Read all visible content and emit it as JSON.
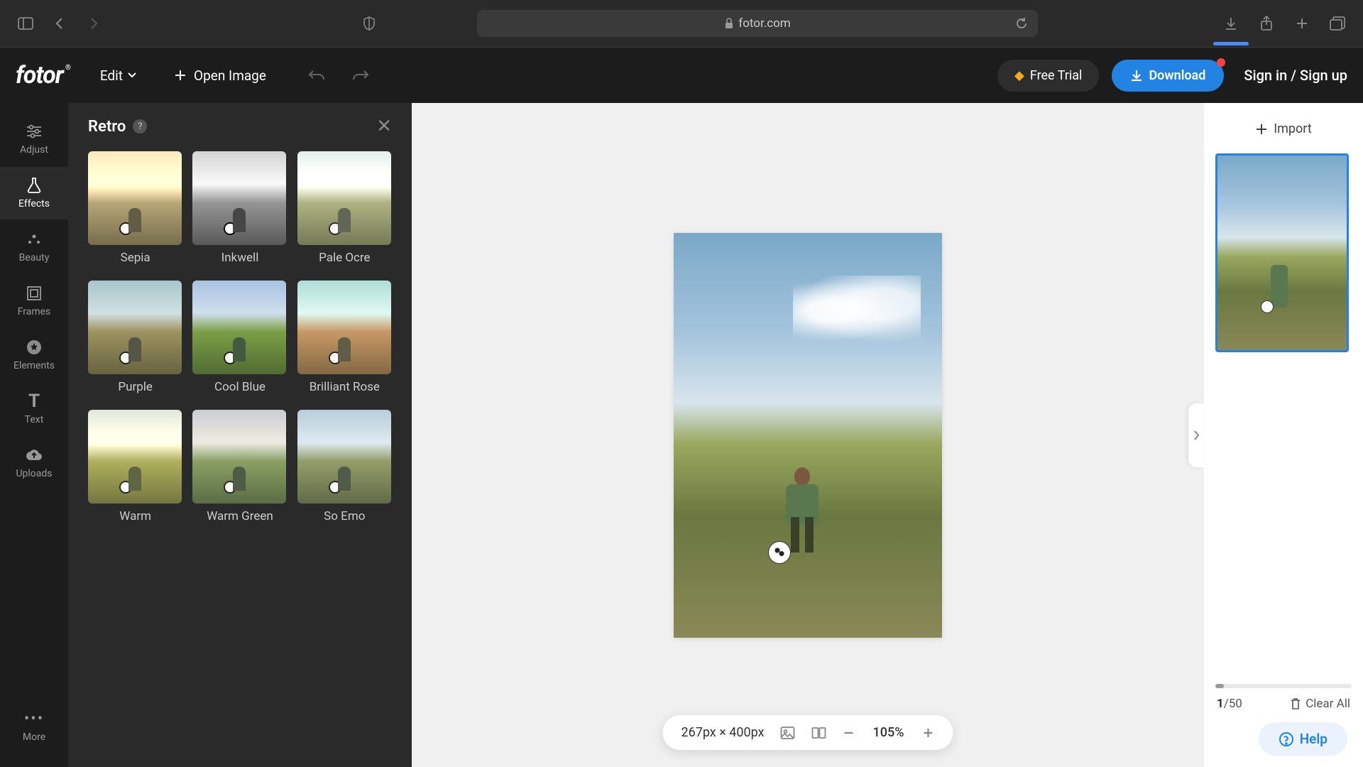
{
  "browser": {
    "url": "fotor.com"
  },
  "header": {
    "logo": "fotor",
    "edit_label": "Edit",
    "open_image_label": "Open Image",
    "free_trial_label": "Free Trial",
    "download_label": "Download",
    "auth_label": "Sign in / Sign up"
  },
  "left_nav": {
    "items": [
      {
        "label": "Adjust",
        "icon": "sliders"
      },
      {
        "label": "Effects",
        "icon": "flask",
        "active": true
      },
      {
        "label": "Beauty",
        "icon": "sparkle"
      },
      {
        "label": "Frames",
        "icon": "frame"
      },
      {
        "label": "Elements",
        "icon": "star"
      },
      {
        "label": "Text",
        "icon": "text"
      },
      {
        "label": "Uploads",
        "icon": "cloud"
      }
    ],
    "more_label": "More"
  },
  "panel": {
    "title": "Retro",
    "effects": [
      {
        "key": "sepia",
        "label": "Sepia"
      },
      {
        "key": "inkwell",
        "label": "Inkwell"
      },
      {
        "key": "paleocre",
        "label": "Pale Ocre"
      },
      {
        "key": "purple",
        "label": "Purple"
      },
      {
        "key": "coolblue",
        "label": "Cool Blue"
      },
      {
        "key": "brilliantrose",
        "label": "Brilliant Rose"
      },
      {
        "key": "warm",
        "label": "Warm"
      },
      {
        "key": "warmgreen",
        "label": "Warm Green"
      },
      {
        "key": "soemo",
        "label": "So Emo"
      }
    ]
  },
  "canvas": {
    "dimensions": "267px × 400px",
    "zoom": "105%"
  },
  "right_panel": {
    "import_label": "Import",
    "current": "1",
    "total": "50",
    "clear_label": "Clear All",
    "help_label": "Help"
  },
  "colors": {
    "accent": "#2383e2",
    "warn": "#ff4444",
    "gold": "#f5a623"
  }
}
